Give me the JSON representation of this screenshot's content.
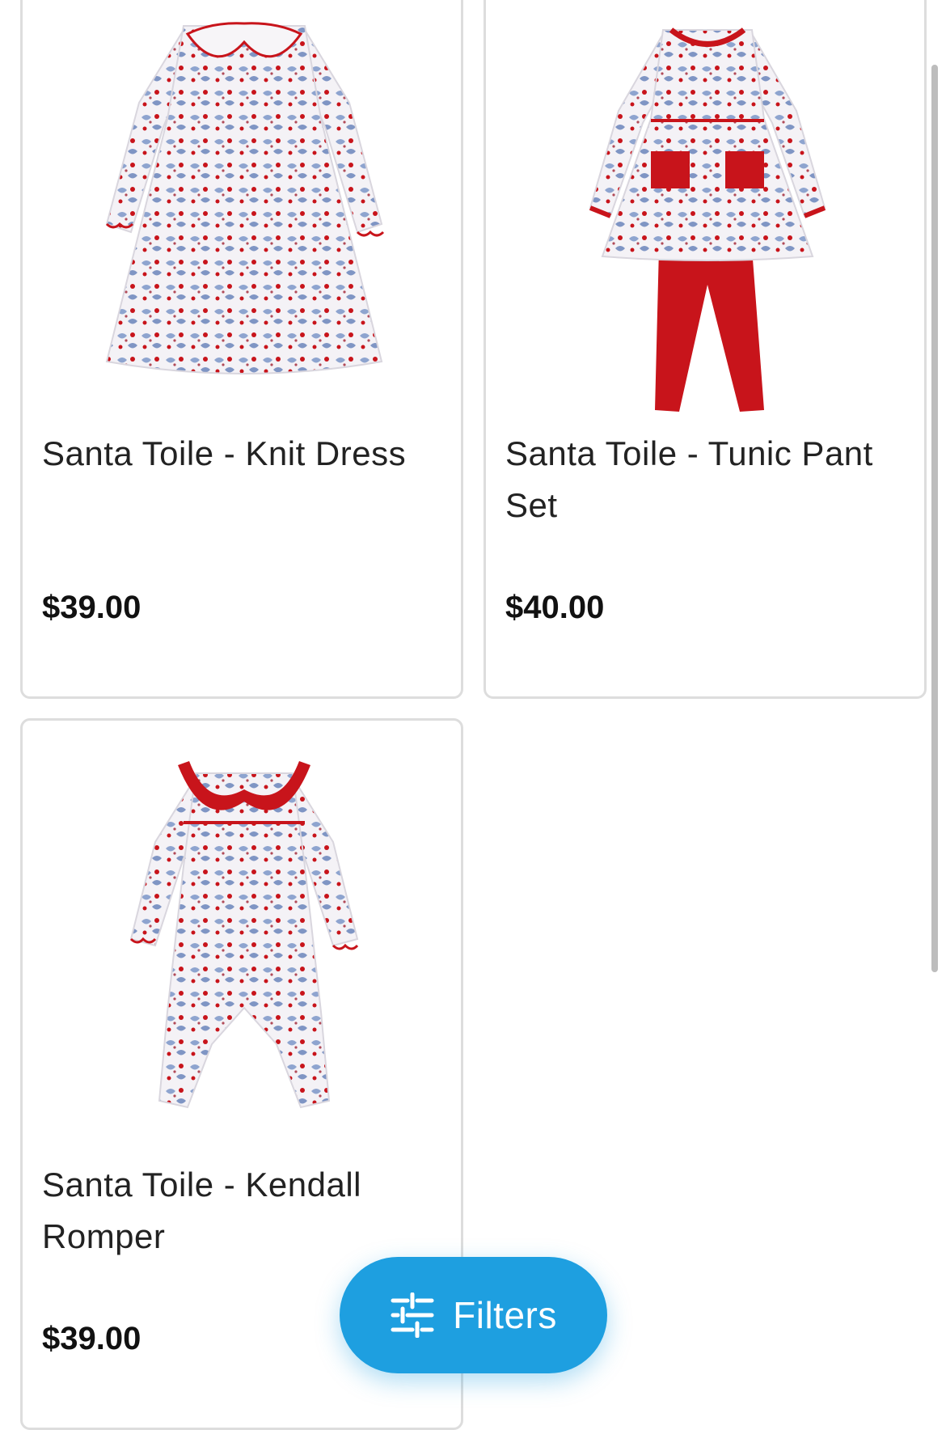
{
  "products": [
    {
      "title": "Santa Toile - Knit Dress",
      "price": "$39.00",
      "image_icon": "knit-dress-image"
    },
    {
      "title": "Santa Toile - Tunic Pant Set",
      "price": "$40.00",
      "image_icon": "tunic-pant-set-image"
    },
    {
      "title": "Santa Toile - Kendall Romper",
      "price": "$39.00",
      "image_icon": "romper-image"
    }
  ],
  "filters_button": {
    "label": "Filters",
    "icon": "sliders-icon"
  },
  "colors": {
    "accent": "#1e9fe0",
    "card_border": "#dddddd",
    "garment_red": "#c8141b",
    "print_blue": "#8ea4cf"
  }
}
